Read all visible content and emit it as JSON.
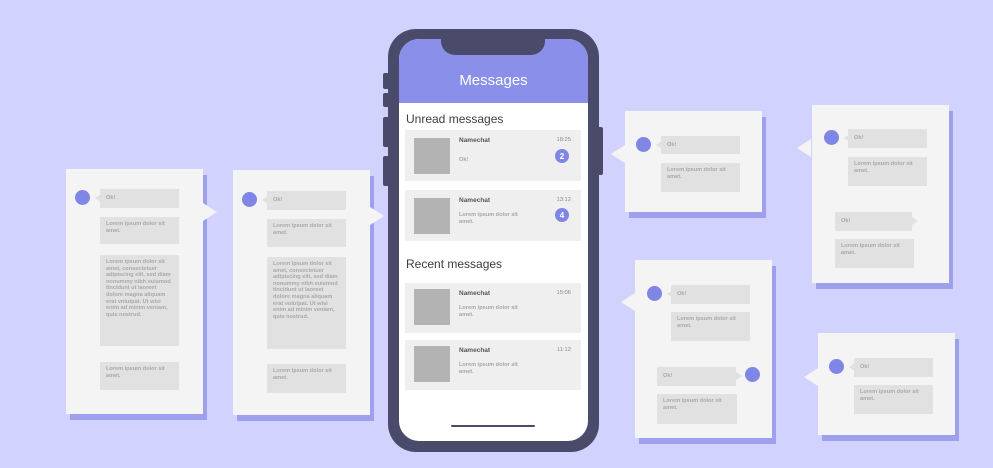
{
  "phone": {
    "title": "Messages",
    "unread_title": "Unread messages",
    "recent_title": "Recent messages",
    "unread": [
      {
        "name": "Namechat",
        "time": "18:25",
        "preview": "Ok!",
        "badge": "2"
      },
      {
        "name": "Namechat",
        "time": "13:12",
        "preview": "Lorem ipsum dolor sit amet.",
        "badge": "4"
      }
    ],
    "recent": [
      {
        "name": "Namechat",
        "time": "15:06",
        "preview": "Lorem ipsum dolor sit amet."
      },
      {
        "name": "Namechat",
        "time": "11:12",
        "preview": "Lorem ipsum dolor sit amet."
      }
    ]
  },
  "chats": {
    "c1": {
      "ok": "Ok!",
      "short1": "Lorem ipsum dolor sit amet.",
      "long": "Lorem ipsum dolor sit amet, consectetuer adipiscing elit, sed diam nonummy nibh euismod tincidunt ut laoreet dolore magna aliquam erat volutpat. Ut wisi enim ad minim veniam, quis nostrud.",
      "short2": "Lorem ipsum dolor sit amet."
    },
    "c2": {
      "ok": "Ok!",
      "short1": "Lorem ipsum dolor sit amet.",
      "long": "Lorem ipsum dolor sit amet, consectetuer adipiscing elit, sed diam nonummy nibh euismod tincidunt ut laoreet dolore magna aliquam erat volutpat. Ut wisi enim ad minim veniam, quis nostrud.",
      "short2": "Lorem ipsum dolor sit amet."
    },
    "c3": {
      "ok": "Ok!",
      "short": "Lorem ipsum dolor sit amet."
    },
    "c4": {
      "ok1": "Ok!",
      "short1": "Lorem ipsum dolor sit amet.",
      "ok2": "Ok!",
      "short2": "Lorem ipsum dolor sit amet."
    },
    "c5": {
      "ok1": "Ok!",
      "short1": "Lorem ipsum dolor sit amet.",
      "ok2": "Ok!",
      "short2": "Lorem ipsum dolor sit amet."
    },
    "c6": {
      "ok": "Ok!",
      "short": "Lorem ipsum dolor sit amet."
    }
  },
  "colors": {
    "background": "#d1d2fd",
    "accent": "#8086e6",
    "header": "#8a90e9",
    "phone_frame": "#4a4a6b"
  }
}
